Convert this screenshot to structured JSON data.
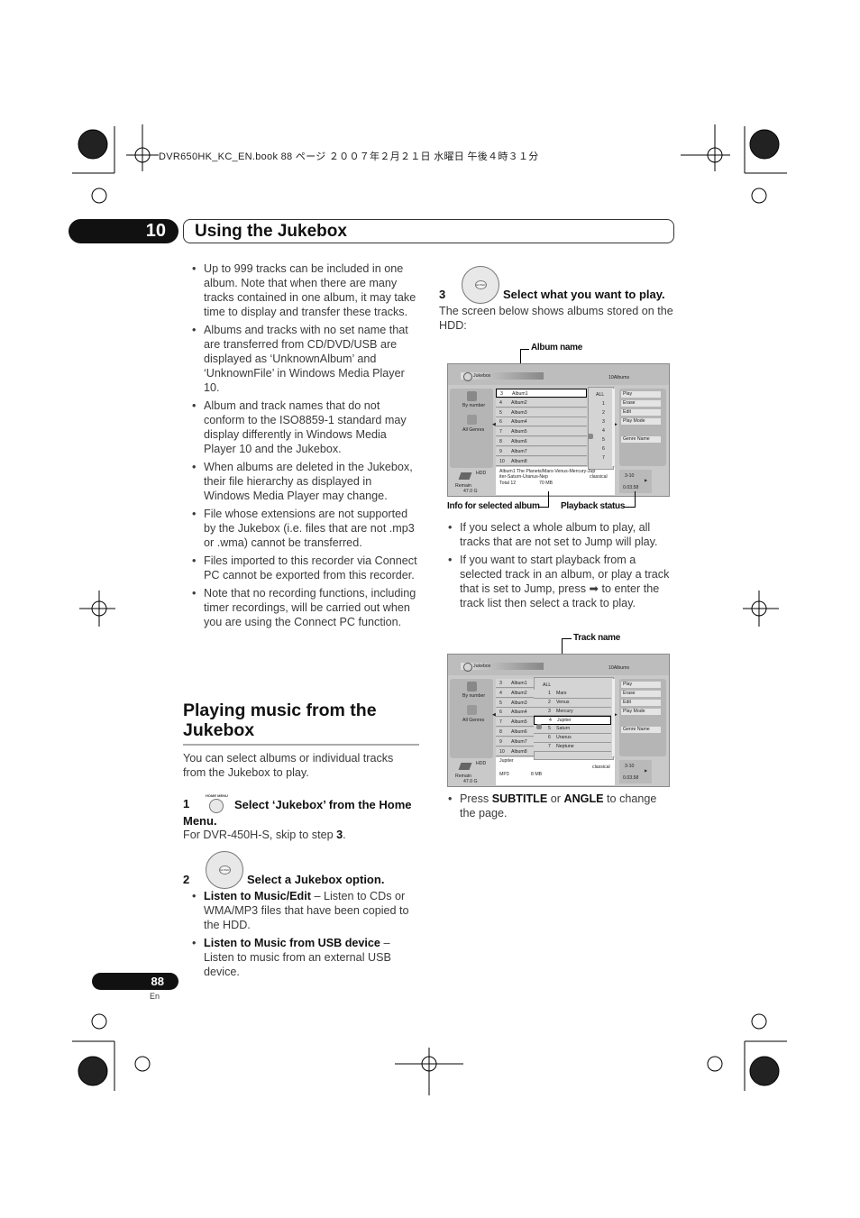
{
  "file_line": "DVR650HK_KC_EN.book  88 ページ  ２００７年２月２１日  水曜日  午後４時３１分",
  "chapter": {
    "number": "10",
    "title": "Using the Jukebox"
  },
  "left_bullets": [
    "Up to 999 tracks can be included in one album. Note that when there are many tracks contained in one album, it may take time to display and transfer these tracks.",
    "Albums and tracks with no set name that are transferred from CD/DVD/USB are displayed as ‘UnknownAlbum’ and ‘UnknownFile’ in Windows Media Player 10.",
    "Album and track names that do not conform to the ISO8859-1 standard may display differently in Windows Media Player 10 and the Jukebox.",
    "When albums are deleted in the Jukebox, their file hierarchy as displayed in Windows Media Player may change.",
    "File whose extensions are not supported by the Jukebox (i.e. files that are not .mp3 or .wma) cannot be transferred.",
    "Files imported to this recorder via Connect PC cannot be exported from this recorder.",
    "Note that no recording functions, including timer recordings, will be carried out when you are using the Connect PC function."
  ],
  "section": {
    "heading": "Playing music from the Jukebox",
    "intro": "You can select albums or individual tracks from the Jukebox to play."
  },
  "step1": {
    "num": "1",
    "button_label": "HOME MENU",
    "title": "Select ‘Jukebox’ from the Home Menu.",
    "note_pre": "For DVR-450H-S, skip to step ",
    "note_bold": "3",
    "note_post": "."
  },
  "step2": {
    "num": "2",
    "button_label": "ENTER",
    "title": "Select a Jukebox option.",
    "options": [
      {
        "bold": "Listen to Music/Edit",
        "rest": " – Listen to CDs or WMA/MP3 files that have been copied to the HDD."
      },
      {
        "bold": "Listen to Music from USB device",
        "rest": " – Listen to music from an external USB device."
      }
    ]
  },
  "step3": {
    "num": "3",
    "button_label": "ENTER",
    "title": "Select what you want to play.",
    "desc": "The screen below shows albums stored on the HDD:"
  },
  "callouts": {
    "album_name": "Album name",
    "info": "Info for selected album",
    "playback": "Playback status",
    "track_name": "Track name"
  },
  "right_bullets": [
    "If you select a whole album to play, all tracks that are not set to Jump will play.",
    "If you want to start playback from a selected track in an album, or play a track that is set to Jump, press ➡ to enter the track list then select a track to play."
  ],
  "last_bullet": {
    "pre": "Press ",
    "b1": "SUBTITLE",
    "mid": " or ",
    "b2": "ANGLE",
    "post": " to change the page."
  },
  "screen_common": {
    "title": "Jukebox",
    "count": "10Albums",
    "by_number": "By number",
    "all_genres": "All Genres",
    "hdd": "HDD",
    "remain": "Remain",
    "remain_val": "47.0 G",
    "options": [
      "Play",
      "Erase",
      "Edit",
      "Play Mode",
      "Genre Name"
    ],
    "pb_track": "3-10",
    "pb_time": "0.03.58",
    "all": "ALL",
    "albums": [
      [
        "3",
        "Album1"
      ],
      [
        "4",
        "Album2"
      ],
      [
        "5",
        "Album3"
      ],
      [
        "6",
        "Album4"
      ],
      [
        "7",
        "Album5"
      ],
      [
        "8",
        "Album6"
      ],
      [
        "9",
        "Album7"
      ],
      [
        "10",
        "Album8"
      ]
    ]
  },
  "screen1": {
    "numbers": [
      "1",
      "2",
      "3",
      "4",
      "5",
      "6",
      "7"
    ],
    "info_line1": "Album1  The Planets/Mars-Venus-Mercury-Jup",
    "info_line2": "iter-Saturn-Uranus-Nep",
    "genre": "classical",
    "total": "Total 12",
    "size": "70 MB"
  },
  "screen2": {
    "tracks": [
      [
        "1",
        "Mars"
      ],
      [
        "2",
        "Venus"
      ],
      [
        "3",
        "Mercury"
      ],
      [
        "4",
        "Jupiter"
      ],
      [
        "5",
        "Saturn"
      ],
      [
        "6",
        "Uranus"
      ],
      [
        "7",
        "Neptune"
      ]
    ],
    "selected_track": "4",
    "info_title": "Jupiter",
    "format": "MP3",
    "size": "8 MB",
    "genre": "classical"
  },
  "page": {
    "number": "88",
    "lang": "En"
  }
}
